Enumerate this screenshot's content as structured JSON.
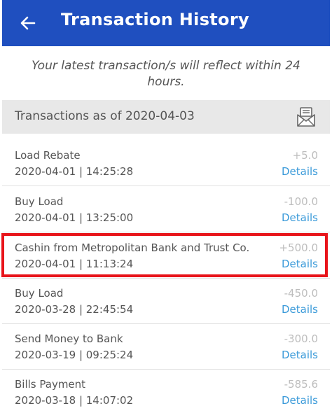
{
  "header": {
    "title": "Transaction History",
    "back_icon": "back-arrow-icon",
    "bg_color": "#1f4fbf"
  },
  "notice": "Your latest transaction/s will reflect within 24 hours.",
  "as_of": {
    "label": "Transactions as of 2020-04-03",
    "icon": "export-mail-icon"
  },
  "transactions": [
    {
      "description": "Load Rebate",
      "datetime": "2020-04-01 | 14:25:28",
      "amount": "+5.0",
      "details": "Details"
    },
    {
      "description": "Buy Load",
      "datetime": "2020-04-01 | 13:25:00",
      "amount": "-100.0",
      "details": "Details"
    },
    {
      "description": "Cashin from Metropolitan Bank and Trust Co.",
      "datetime": "2020-04-01 | 11:13:24",
      "amount": "+500.0",
      "details": "Details"
    },
    {
      "description": "Buy Load",
      "datetime": "2020-03-28 | 22:45:54",
      "amount": "-450.0",
      "details": "Details"
    },
    {
      "description": "Send Money to Bank",
      "datetime": "2020-03-19 | 09:25:24",
      "amount": "-300.0",
      "details": "Details"
    },
    {
      "description": "Bills Payment",
      "datetime": "2020-03-18 | 14:07:02",
      "amount": "-585.6",
      "details": "Details"
    }
  ],
  "colors": {
    "accent": "#1f4fbf",
    "link": "#3a9ad9",
    "highlight": "#e8141a"
  }
}
